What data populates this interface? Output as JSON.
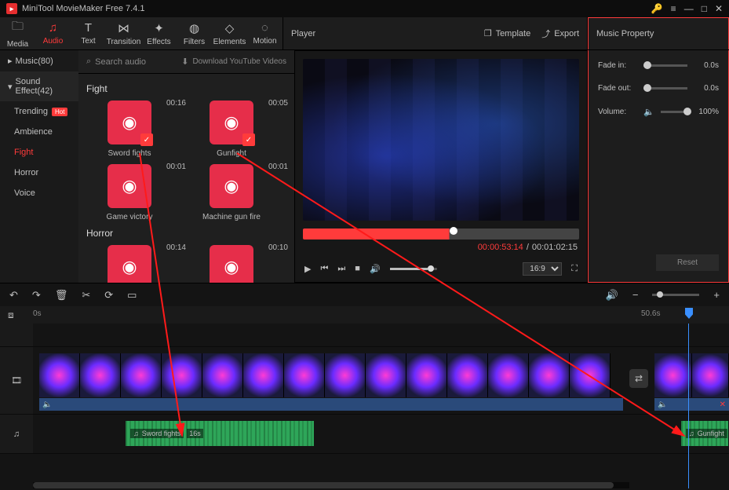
{
  "app": {
    "title": "MiniTool MovieMaker Free 7.4.1"
  },
  "toolbar": {
    "tabs": [
      {
        "label": "Media",
        "icon": "folder"
      },
      {
        "label": "Audio",
        "icon": "music",
        "active": true
      },
      {
        "label": "Text",
        "icon": "T"
      },
      {
        "label": "Transition",
        "icon": "bowtie"
      },
      {
        "label": "Effects",
        "icon": "sparkle"
      },
      {
        "label": "Filters",
        "icon": "funnel"
      },
      {
        "label": "Elements",
        "icon": "shapes"
      },
      {
        "label": "Motion",
        "icon": "orbit"
      }
    ]
  },
  "player_header": {
    "title": "Player",
    "template": "Template",
    "export": "Export"
  },
  "props_header": {
    "title": "Music Property"
  },
  "sidebar": {
    "categories": [
      {
        "label": "Music(80)",
        "expanded": false
      },
      {
        "label": "Sound Effect(42)",
        "expanded": true
      }
    ],
    "subs": [
      {
        "label": "Trending",
        "hot": true
      },
      {
        "label": "Ambience"
      },
      {
        "label": "Fight",
        "active": true
      },
      {
        "label": "Horror"
      },
      {
        "label": "Voice"
      }
    ]
  },
  "assets": {
    "search_placeholder": "Search audio",
    "download_label": "Download YouTube Videos",
    "sections": [
      {
        "title": "Fight",
        "items": [
          {
            "name": "Sword fights",
            "duration": "00:16",
            "checked": true
          },
          {
            "name": "Gunfight",
            "duration": "00:05",
            "checked": true
          },
          {
            "name": "Game victory",
            "duration": "00:01"
          },
          {
            "name": "Machine gun fire",
            "duration": "00:01"
          }
        ]
      },
      {
        "title": "Horror",
        "items": [
          {
            "name": "",
            "duration": "00:14"
          },
          {
            "name": "",
            "duration": "00:10"
          }
        ]
      }
    ]
  },
  "player": {
    "time_current": "00:00:53:14",
    "time_total": "00:01:02:15",
    "aspect": "16:9"
  },
  "properties": {
    "fade_in": {
      "label": "Fade in:",
      "value": "0.0s"
    },
    "fade_out": {
      "label": "Fade out:",
      "value": "0.0s"
    },
    "volume": {
      "label": "Volume:",
      "value": "100%"
    },
    "reset": "Reset"
  },
  "timeline": {
    "ruler": {
      "start": "0s",
      "mark": "50.6s"
    },
    "clips": {
      "sword": {
        "label": "Sword fights",
        "duration": "16s"
      },
      "gun": {
        "label": "Gunfight"
      }
    }
  },
  "icons": {
    "search": "⌕",
    "download": "⬇",
    "template": "❐",
    "export": "⤴",
    "undo": "↶",
    "redo": "↷",
    "trash": "🗑",
    "cut": "✂",
    "speed": "⟳",
    "crop": "▭",
    "speaker": "🔊",
    "minus": "−",
    "plus": "+",
    "play": "▶",
    "prev": "⏮",
    "next": "⏭",
    "stop": "■",
    "fullscreen": "⛶",
    "note": "♫",
    "film": "🎞",
    "snap": "⧈",
    "swap": "⇄",
    "vol_icon": "🔈",
    "key": "🔑",
    "menu": "≡",
    "min": "—",
    "max": "□",
    "close": "✕",
    "chev_r": "▸",
    "chev_d": "▾",
    "check": "✓"
  }
}
